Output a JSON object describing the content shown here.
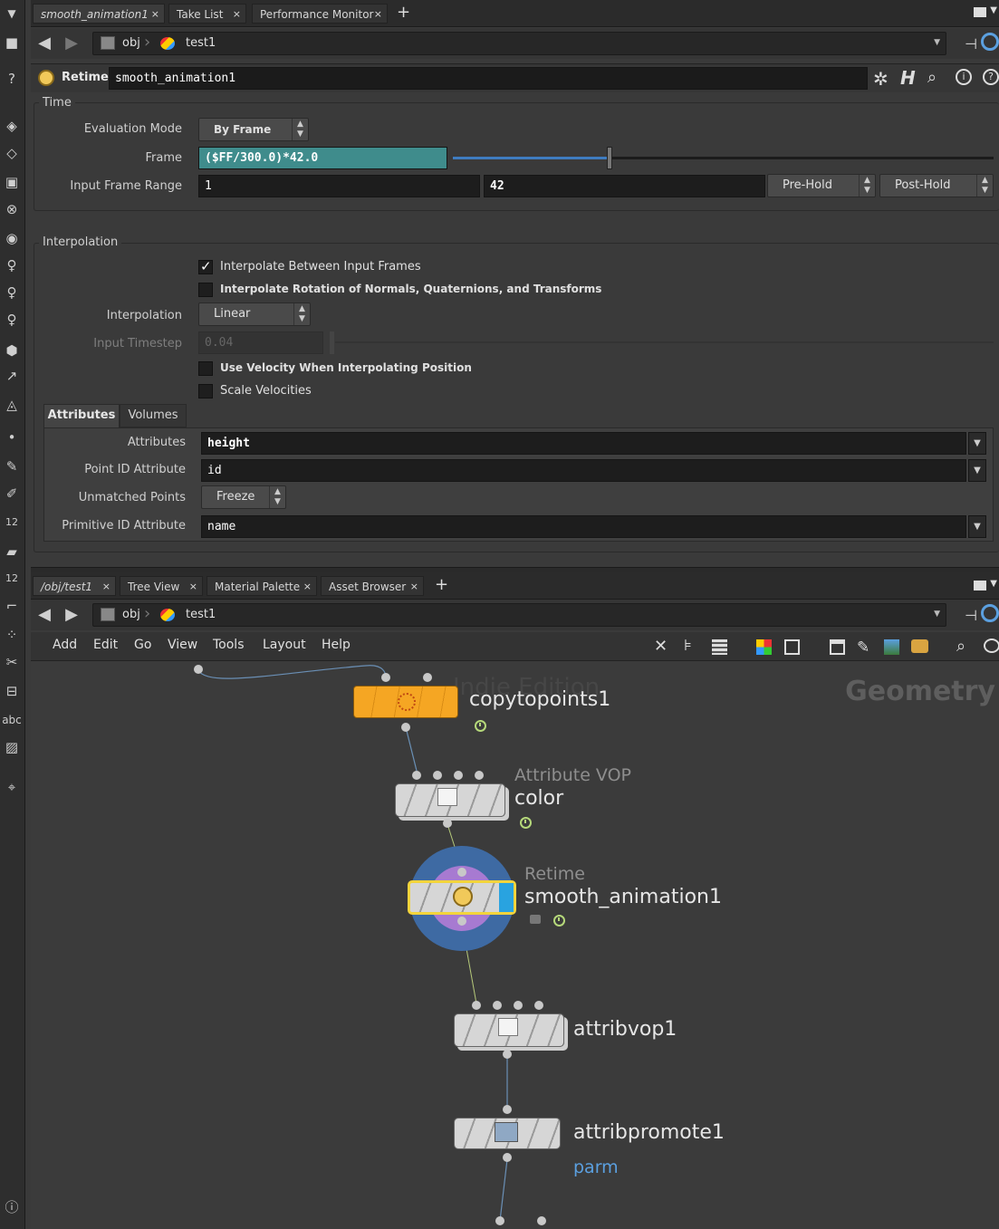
{
  "top_tabs": [
    {
      "label": "smooth_animation1"
    },
    {
      "label": "Take List"
    },
    {
      "label": "Performance Monitor"
    }
  ],
  "path": {
    "obj": "obj",
    "net": "test1"
  },
  "param_header": {
    "type_label": "Retime",
    "node_name": "smooth_animation1"
  },
  "time_section": {
    "title": "Time",
    "eval_mode_label": "Evaluation Mode",
    "eval_mode_value": "By Frame",
    "frame_label": "Frame",
    "frame_value": "($FF/300.0)*42.0",
    "frame_slider_fraction": 0.29,
    "range_label": "Input Frame Range",
    "range_start": "1",
    "range_end": "42",
    "pre_hold": "Pre-Hold",
    "post_hold": "Post-Hold"
  },
  "interp_section": {
    "title": "Interpolation",
    "cb_interp_frames": "Interpolate Between Input Frames",
    "cb_interp_frames_checked": true,
    "cb_interp_rot": "Interpolate Rotation of Normals, Quaternions, and Transforms",
    "cb_interp_rot_checked": false,
    "interp_label": "Interpolation",
    "interp_value": "Linear",
    "timestep_label": "Input Timestep",
    "timestep_value": "0.04",
    "cb_velocity": "Use Velocity When Interpolating Position",
    "cb_velocity_checked": false,
    "cb_scale_vel": "Scale Velocities",
    "cb_scale_vel_checked": false
  },
  "attr_tabs": {
    "tab1": "Attributes",
    "tab2": "Volumes"
  },
  "attr_params": {
    "attributes_label": "Attributes",
    "attributes_value": "height",
    "point_id_label": "Point ID Attribute",
    "point_id_value": "id",
    "unmatched_label": "Unmatched Points",
    "unmatched_value": "Freeze",
    "prim_id_label": "Primitive ID Attribute",
    "prim_id_value": "name"
  },
  "bottom_tabs": [
    {
      "label": "/obj/test1"
    },
    {
      "label": "Tree View"
    },
    {
      "label": "Material Palette"
    },
    {
      "label": "Asset Browser"
    }
  ],
  "menu": [
    "Add",
    "Edit",
    "Go",
    "View",
    "Tools",
    "Layout",
    "Help"
  ],
  "network": {
    "watermark": "Indie Edition",
    "context": "Geometry",
    "nodes": {
      "copytopoints": "copytopoints1",
      "color_type": "Attribute VOP",
      "color": "color",
      "retime_type": "Retime",
      "retime": "smooth_animation1",
      "attribvop": "attribvop1",
      "attribpromote": "attribpromote1",
      "attribpromote_parm": "parm"
    }
  },
  "shelf_text": {
    "num1": "12",
    "num2": "12",
    "abc": "abc"
  },
  "colors": {
    "accent_teal": "#3f8c8c",
    "node_orange": "#f5a623",
    "selected_yellow": "#f2d43c",
    "link_blue": "#5ba0e0"
  }
}
